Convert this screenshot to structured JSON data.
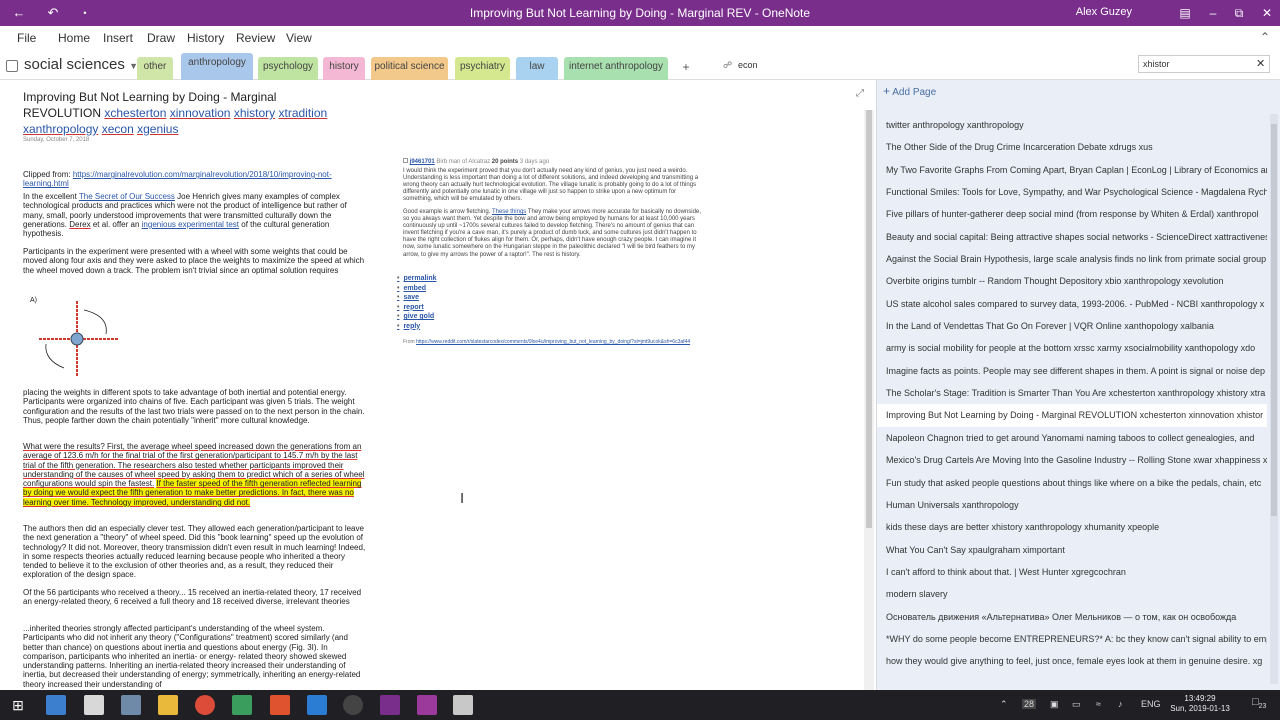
{
  "window": {
    "title": "Improving But Not Learning by Doing - Marginal REV  -  OneNote",
    "user": "Alex Guzey"
  },
  "menu": [
    "File",
    "Home",
    "Insert",
    "Draw",
    "History",
    "Review",
    "View"
  ],
  "notebook": {
    "name": "social sciences"
  },
  "section_tabs": [
    {
      "label": "other",
      "color": "#cfe6a8"
    },
    {
      "label": "anthropology",
      "color": "#a9c7ea"
    },
    {
      "label": "psychology",
      "color": "#bfe3a0"
    },
    {
      "label": "history",
      "color": "#f4b8d4"
    },
    {
      "label": "political science",
      "color": "#f3c98b"
    },
    {
      "label": "psychiatry",
      "color": "#d6e88f"
    },
    {
      "label": "law",
      "color": "#a9d2f0"
    },
    {
      "label": "internet anthropology",
      "color": "#a9e0b0"
    }
  ],
  "add_section": "+",
  "extra_section": "econ",
  "search": {
    "value": "xhistor"
  },
  "page": {
    "title_plain": "Improving But Not Learning by Doing - Marginal REVOLUTION",
    "title_tags": [
      "xchesterton",
      "xinnovation",
      "xhistory",
      "xtradition",
      "xanthropology",
      "xecon",
      "xgenius"
    ],
    "date": "Sunday, October 7, 2018",
    "clipped_label": "Clipped from:",
    "clipped_url": "https://marginalrevolution.com/marginalrevolution/2018/10/improving-not-learning.html",
    "para1_a": "In the excellent",
    "para1_link": "The Secret of Our Success",
    "para1_b": "Joe Henrich gives many examples of complex technological products and practices which were not the product of intelligence but rather of many, small, poorly understood improvements that were transmitted culturally down the generations.",
    "para1_c": "Derex",
    "para1_d": "et al. offer an",
    "para1_link2": "ingenious experimental test",
    "para1_e": "of the cultural generation hypothesis.",
    "para2": "Participants in the experiment were presented with a wheel with some weights that could be moved along four axis and they were asked to place the weights to maximize the speed at which the wheel moved down a track. The problem isn't trivial since an optimal solution requires",
    "figure_label": "A)",
    "para3": "placing the weights in different spots to take advantage of both inertial and potential energy. Participants were organized into chains of five. Each participant was given 5 trials. The weight configuration and the results of the last two trials were passed on to the next person in the chain. Thus, people farther down the chain potentially \"inherit\" more cultural knowledge.",
    "para4_a": "What were the results? First, the average wheel speed increased down the generations from an average of 123.6 m/h for the final trial of the first generation/participant to 145.7 m/h by the last trial of the fifth generation. The researchers also tested whether participants improved their understanding of the causes of wheel speed by asking them to predict which of a series of wheel configurations would spin the fastest.",
    "para4_hl": "If the faster speed of the fifth generation reflected learning by doing we would expect the fifth generation to make better predictions. In fact, there was no learning over time. Technology improved, understanding did not.",
    "para5": "The authors then did an especially clever test. They allowed each generation/participant to leave the next generation a \"theory\" of wheel speed. Did this \"book learning\" speed up the evolution of technology? It did not. Moreover, theory transmission didn't even result in much learning! Indeed, in some respects theories actually reduced learning because people who inherited a theory tended to believe it to the exclusion of other theories and, as a result, they reduced their exploration of the design space.",
    "para6": "Of the 56 participants who received a theory... 15 received an inertia-related theory, 17 received an energy-related theory, 6 received a full theory and 18 received diverse, irrelevant theories",
    "para7": "...inherited theories strongly affected participant's understanding of the wheel system. Participants who did not inherit any theory (\"Configurations\" treatment) scored similarly (and better than chance) on questions about inertia and questions about energy (Fig. 3I). In comparison, participants who inherited an inertia- or energy- related theory showed skewed understanding patterns. Inheriting an inertia-related theory increased their understanding of inertia, but decreased their understanding of energy; symmetrically, inheriting an energy-related theory increased their understanding of"
  },
  "reddit": {
    "user_id": "j9461701",
    "flair": "Birb",
    "username": "man of Alcatraz",
    "points": "20 points",
    "ago": "3 days ago",
    "body1": "I would think the experiment proved that you don't actually need any kind of genius, you just need a weirdo. Understanding is less important than doing a lot of different solutions, and indeed developing and transmitting a wrong theory can actually hurt technological evolution. The village lunatic is probably going to do a lot of things differently and potentially one lunatic in one village will just so happen to strike upon a new optimum for something, which will be emulated by others.",
    "body2_a": "Good example is arrow fletching.",
    "body2_link": "These things",
    "body2_b": "They make your arrows more accurate for basically no downside, so you always want them. Yet despite the bow and arrow being employed by humans for at least 10,000 years continuously up until ~1700s several cultures failed to develop fletching. There's no amount of genius that can invent fletching if you're a cave man, it's purely a product of dumb luck, and some cultures just didn't happen to have the right collection of flukes align for them. Or, perhaps, didn't have enough crazy people. I can imagine it now, some lunatic somewhere on the Hungarian steppe in the paleolithic declared \"I will tie bird feathers to my arrow, to give my arrows the power of a raptor!\". The rest is history.",
    "actions": [
      "permalink",
      "embed",
      "save",
      "report",
      "give gold",
      "reply"
    ],
    "from_label": "From",
    "from_url": "https://www.reddit.com/r/slatestarcodex/comments/9lxe4u/improving_but_not_learning_by_doing/?st=jmt9ucok&sh=6c3af44"
  },
  "pages_pane": {
    "add_page": "Add Page",
    "items": [
      "twitter anthropology xanthropology",
      "The Other Side of the Drug Crime Incarceration Debate xdrugs xus",
      "My Two Favorite Graphs From Coming Apart, Bryan Caplan | EconLog | Library of Economics an",
      "Functional Smiles: Tools for Love, Sympathy, and War Psychological Science - Magdalena Rychl",
      "Five pillars of hunter-gatherer deep social mind (from response by Whiten & Erdal) xanthropol",
      "Beauty and social capital: Being attractive shapes social networks - ScienceDirect xattractivenes",
      "Against the Social Brain Hypothesis, large scale analysis finds no link from primate social group",
      "Overbite origins tumblr -- Random Thought Depository xbio xanthropology xevolution",
      "US state alcohol sales compared to survey data, 1993-2006. - PubMed - NCBI xanthropology x",
      "In the Land of Vendettas That Go On Forever | VQR Online xanthopology xalbania",
      "army is social mobility for people at the bottom xrssc xarmy xsocialmobility xanthopology xdo",
      "Imagine facts as points. People may see different shapes in them. A point is signal or noise dep",
      "The Scholar's Stage: Tradition is Smarter Than You Are xchesterton xanthropology xhistory xtra",
      "Improving But Not Learning by Doing - Marginal REVOLUTION xchesterton xinnovation xhistor",
      "Napoleon Chagnon tried to get around Yanomami naming taboos to collect genealogies, and",
      "Mexico's Drug Cartels Are Moving Into the Gasoline Industry -- Rolling Stone xwar xhappiness x",
      "Fun study that asked people questions about things like where on a bike the pedals, chain, etc",
      "Human Universals xanthropology",
      "kids these days are better xhistory xanthropology xhumanity xpeople",
      "What You Can't Say xpaulgraham ximportant",
      "I can't afford to think about that. | West Hunter xgregcochran",
      "modern slavery",
      "       Основатель движения «Альтернатива» Олег Мельников — о том, как он освобожда",
      "*WHY do some people become ENTREPRENEURS?* A: bc they know can't signal ability to empl",
      "how they would give anything to feel, just once, female eyes look at them in genuine desire. xg"
    ],
    "selected_index": 13
  },
  "taskbar": {
    "tray_lang": "ENG",
    "tray_num": "28",
    "time": "13:49:29",
    "date": "Sun, 2019-01-13",
    "notif": "23"
  }
}
